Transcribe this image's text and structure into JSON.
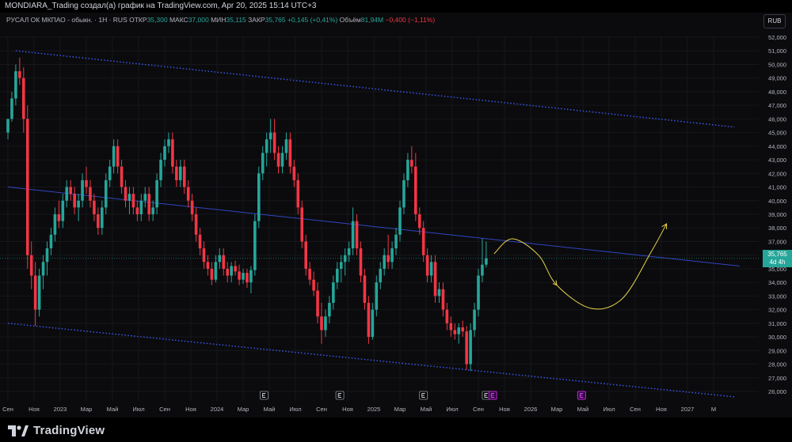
{
  "header": {
    "attribution": "MONDIARA_Trading создал(а) график на TradingView.com, Apr 20, 2025 15:14 UTC+3"
  },
  "info": {
    "symbol": "РУСАЛ ОК МКПАО - обыкн. · 1H · RUS",
    "open_label": "ОТКР",
    "open": "35,300",
    "high_label": "МАКС",
    "high": "37,000",
    "low_label": "МИН",
    "low": "35,115",
    "close_label": "ЗАКР",
    "close": "35,765",
    "change": "+0,145 (+0,41%)",
    "volume_label": "Объём",
    "volume": "81,94M",
    "volume_change": "−0,400 (−1,11%)"
  },
  "currency": "RUB",
  "price_tag": {
    "price": "35,765",
    "countdown": "4d 4h"
  },
  "brand": "TradingView",
  "colors": {
    "up": "#26a69a",
    "down": "#f23645",
    "channel": "#3d5afe",
    "arrow": "#e6d34a",
    "background": "#0b0b0d"
  },
  "icons": [
    "tradingview-logo-icon",
    "earnings-e-icon",
    "dividend-marker-icon"
  ],
  "chart_data": {
    "type": "candlestick",
    "x_tick_labels": [
      "Сен",
      "Ноя",
      "2023",
      "Мар",
      "Май",
      "Июл",
      "Сен",
      "Ноя",
      "2024",
      "Мар",
      "Май",
      "Июл",
      "Сен",
      "Ноя",
      "2025",
      "Мар",
      "Май",
      "Июл",
      "Сен",
      "Ноя",
      "2026",
      "Мар",
      "Май",
      "Июл",
      "Сен",
      "Ноя",
      "2027",
      "М"
    ],
    "y_ticks": [
      26,
      27,
      28,
      29,
      30,
      31,
      32,
      33,
      34,
      35,
      36,
      37,
      38,
      39,
      40,
      41,
      42,
      43,
      44,
      45,
      46,
      47,
      48,
      49,
      50,
      51,
      52
    ],
    "y_tick_labels": [
      "26,000",
      "27,000",
      "28,000",
      "29,000",
      "30,000",
      "31,000",
      "32,000",
      "33,000",
      "34,000",
      "35,000",
      "36,000",
      "37,000",
      "38,000",
      "39,000",
      "40,000",
      "41,000",
      "42,000",
      "43,000",
      "44,000",
      "45,000",
      "46,000",
      "47,000",
      "48,000",
      "49,000",
      "50,000",
      "51,000",
      "52,000"
    ],
    "ylim": [
      25.5,
      52.5
    ],
    "xlim": [
      0,
      28
    ],
    "candles": [
      [
        0.0,
        45,
        46,
        44.5,
        46
      ],
      [
        0.15,
        46,
        48,
        45.8,
        47.5
      ],
      [
        0.3,
        47.5,
        50,
        47,
        49.5
      ],
      [
        0.45,
        49.5,
        50.5,
        48.5,
        49
      ],
      [
        0.6,
        49,
        49.8,
        45,
        46
      ],
      [
        0.75,
        46,
        47,
        35,
        36
      ],
      [
        0.9,
        36,
        37,
        33.5,
        34.5
      ],
      [
        1.05,
        34.5,
        35.5,
        30.8,
        32
      ],
      [
        1.2,
        32,
        35,
        31.5,
        34.5
      ],
      [
        1.35,
        34.5,
        36,
        33.5,
        35.5
      ],
      [
        1.5,
        35.5,
        37,
        34.5,
        36.5
      ],
      [
        1.65,
        36.5,
        38,
        36,
        37.5
      ],
      [
        1.8,
        37.5,
        39.5,
        37,
        39
      ],
      [
        1.95,
        39,
        40,
        38,
        38.5
      ],
      [
        2.1,
        38.5,
        40.5,
        38,
        40
      ],
      [
        2.25,
        40,
        41.5,
        39.5,
        41
      ],
      [
        2.4,
        41,
        41.5,
        40,
        40.5
      ],
      [
        2.55,
        40.5,
        41,
        39,
        39.5
      ],
      [
        2.7,
        39.5,
        40.5,
        38.5,
        40
      ],
      [
        2.85,
        40,
        42,
        39.5,
        41.5
      ],
      [
        3.0,
        41.5,
        42.5,
        40.5,
        41
      ],
      [
        3.15,
        41,
        41.5,
        39.5,
        40
      ],
      [
        3.3,
        40,
        40.5,
        38.5,
        39
      ],
      [
        3.45,
        39,
        39.5,
        37.5,
        38
      ],
      [
        3.6,
        38,
        40,
        37.5,
        39.5
      ],
      [
        3.75,
        39.5,
        42,
        39,
        41.5
      ],
      [
        3.9,
        41.5,
        43,
        41,
        42.5
      ],
      [
        4.05,
        42.5,
        44.5,
        42,
        44
      ],
      [
        4.2,
        44,
        44.5,
        42,
        42.5
      ],
      [
        4.35,
        42.5,
        43,
        40.5,
        41
      ],
      [
        4.5,
        41,
        41.5,
        39.5,
        40
      ],
      [
        4.65,
        40,
        41,
        39,
        40.5
      ],
      [
        4.8,
        40.5,
        41,
        39,
        39.5
      ],
      [
        4.95,
        39.5,
        40,
        38.5,
        39
      ],
      [
        5.1,
        39,
        40.5,
        38.5,
        40
      ],
      [
        5.25,
        40,
        41,
        39.5,
        40.5
      ],
      [
        5.4,
        40.5,
        41,
        38.5,
        39
      ],
      [
        5.55,
        39,
        40,
        38.5,
        39.5
      ],
      [
        5.7,
        39.5,
        42,
        39,
        41.5
      ],
      [
        5.85,
        41.5,
        43.5,
        41,
        43
      ],
      [
        6.0,
        43,
        44.5,
        42.5,
        44
      ],
      [
        6.15,
        44,
        45,
        43.5,
        44.5
      ],
      [
        6.3,
        44.5,
        45,
        42,
        42.5
      ],
      [
        6.45,
        42.5,
        43,
        41,
        41.5
      ],
      [
        6.6,
        41.5,
        43,
        41,
        42.5
      ],
      [
        6.75,
        42.5,
        43,
        40.5,
        41
      ],
      [
        6.9,
        41,
        41.5,
        39.5,
        40
      ],
      [
        7.05,
        40,
        40.5,
        38.5,
        39
      ],
      [
        7.2,
        39,
        39.5,
        37,
        37.5
      ],
      [
        7.35,
        37.5,
        38,
        36,
        36.5
      ],
      [
        7.5,
        36.5,
        37,
        35,
        35.5
      ],
      [
        7.65,
        35.5,
        36,
        34.5,
        35
      ],
      [
        7.8,
        35,
        35.5,
        33.8,
        34.2
      ],
      [
        7.95,
        34.2,
        36,
        34,
        35.5
      ],
      [
        8.1,
        35.5,
        36.5,
        35,
        36
      ],
      [
        8.25,
        36,
        36.5,
        34.5,
        35
      ],
      [
        8.4,
        35,
        35.5,
        34,
        34.5
      ],
      [
        8.55,
        34.5,
        35.5,
        34,
        35.2
      ],
      [
        8.7,
        35.2,
        35.6,
        34.5,
        34.8
      ],
      [
        8.85,
        34.8,
        35.3,
        33.8,
        34.2
      ],
      [
        9.0,
        34.2,
        35,
        33.9,
        34.7
      ],
      [
        9.15,
        34.7,
        35,
        33.6,
        34.0
      ],
      [
        9.3,
        34.0,
        35.2,
        33.2,
        34.9
      ],
      [
        9.45,
        34.9,
        39,
        34.5,
        38.5
      ],
      [
        9.6,
        38.5,
        42.5,
        38,
        42
      ],
      [
        9.75,
        42,
        44,
        41.5,
        43.5
      ],
      [
        9.9,
        43.5,
        45,
        42.5,
        44.5
      ],
      [
        10.05,
        44.5,
        46,
        43.5,
        45
      ],
      [
        10.2,
        45,
        46,
        43,
        43.5
      ],
      [
        10.35,
        43.5,
        44,
        42,
        42.5
      ],
      [
        10.5,
        42.5,
        44,
        42,
        43.5
      ],
      [
        10.65,
        43.5,
        45,
        43,
        44.5
      ],
      [
        10.8,
        44.5,
        45,
        42,
        42.5
      ],
      [
        10.95,
        42.5,
        43,
        41,
        41.5
      ],
      [
        11.1,
        41.5,
        42,
        39,
        39.5
      ],
      [
        11.25,
        39.5,
        40,
        36.5,
        37
      ],
      [
        11.4,
        37,
        37.5,
        34.5,
        35
      ],
      [
        11.55,
        35,
        35.5,
        33.8,
        34.2
      ],
      [
        11.7,
        34.2,
        34.8,
        33,
        33.4
      ],
      [
        11.85,
        33.4,
        34,
        31,
        31.5
      ],
      [
        12.0,
        31.5,
        32.5,
        29.5,
        30.5
      ],
      [
        12.15,
        30.5,
        32,
        30,
        31.5
      ],
      [
        12.3,
        31.5,
        33,
        31,
        32.5
      ],
      [
        12.45,
        32.5,
        34.5,
        32,
        34
      ],
      [
        12.6,
        34,
        35.5,
        33.5,
        35
      ],
      [
        12.75,
        35,
        36,
        34,
        35.5
      ],
      [
        12.9,
        35.5,
        36.5,
        34.5,
        36
      ],
      [
        13.05,
        36,
        37,
        35.5,
        36.5
      ],
      [
        13.2,
        36.5,
        39.5,
        36,
        38.5
      ],
      [
        13.35,
        38.5,
        39,
        36,
        36.5
      ],
      [
        13.5,
        36.5,
        37,
        34,
        34.5
      ],
      [
        13.65,
        34.5,
        35,
        32,
        32.5
      ],
      [
        13.8,
        32.5,
        33,
        29.5,
        30
      ],
      [
        13.95,
        30,
        32.5,
        29.8,
        32
      ],
      [
        14.1,
        32,
        34.5,
        31.5,
        34
      ],
      [
        14.25,
        34,
        35.5,
        33.5,
        35
      ],
      [
        14.4,
        35,
        36.5,
        34.5,
        36
      ],
      [
        14.55,
        36,
        37.5,
        35,
        35.5
      ],
      [
        14.7,
        35.5,
        37,
        35,
        36.5
      ],
      [
        14.85,
        36.5,
        38,
        36,
        37.5
      ],
      [
        15.0,
        37.5,
        40,
        37,
        39.5
      ],
      [
        15.15,
        39.5,
        42,
        39,
        41.5
      ],
      [
        15.3,
        41.5,
        43.5,
        41,
        43
      ],
      [
        15.45,
        43,
        44,
        42,
        42.5
      ],
      [
        15.6,
        42.5,
        43.5,
        38.5,
        39
      ],
      [
        15.75,
        39,
        39.5,
        37.5,
        38
      ],
      [
        15.9,
        38,
        38.5,
        35.5,
        36
      ],
      [
        16.05,
        36,
        36.5,
        34,
        34.5
      ],
      [
        16.2,
        34.5,
        36,
        34,
        35.5
      ],
      [
        16.35,
        35.5,
        36,
        32.5,
        33
      ],
      [
        16.5,
        33,
        34,
        32.5,
        33.5
      ],
      [
        16.65,
        33.5,
        34,
        31.5,
        32
      ],
      [
        16.8,
        32,
        32.5,
        30.5,
        31
      ],
      [
        16.95,
        31,
        31.5,
        30,
        30.5
      ],
      [
        17.1,
        30.5,
        31,
        29.8,
        30.2
      ],
      [
        17.25,
        30.2,
        31,
        29.5,
        30.7
      ],
      [
        17.4,
        30.7,
        31.2,
        30,
        30.4
      ],
      [
        17.55,
        30.4,
        30.8,
        27.6,
        28
      ],
      [
        17.7,
        28,
        31,
        27.5,
        30.5
      ],
      [
        17.85,
        30.5,
        32.5,
        30,
        32
      ],
      [
        18.0,
        32,
        35,
        31.5,
        34.5
      ],
      [
        18.15,
        34.5,
        37.2,
        34,
        35.3
      ],
      [
        18.3,
        35.3,
        37,
        35.1,
        35.765
      ]
    ],
    "channel": {
      "upper": [
        [
          0.3,
          51
        ],
        [
          27.8,
          45.4
        ]
      ],
      "middle": [
        [
          0,
          41
        ],
        [
          28,
          35.2
        ]
      ],
      "lower": [
        [
          0,
          31
        ],
        [
          27.8,
          25.6
        ]
      ]
    },
    "price_line": 35.765,
    "earnings_markers": [
      9.8,
      12.7,
      15.9,
      18.3
    ],
    "dividend_markers": [
      18.55,
      21.95
    ],
    "projection": [
      [
        18.6,
        36.1
      ],
      [
        19.3,
        37.2
      ],
      [
        20.3,
        36.0
      ],
      [
        21.0,
        33.8
      ],
      [
        22.3,
        32.1
      ],
      [
        23.5,
        32.8
      ],
      [
        24.6,
        36.2
      ],
      [
        25.2,
        38.3
      ]
    ]
  }
}
